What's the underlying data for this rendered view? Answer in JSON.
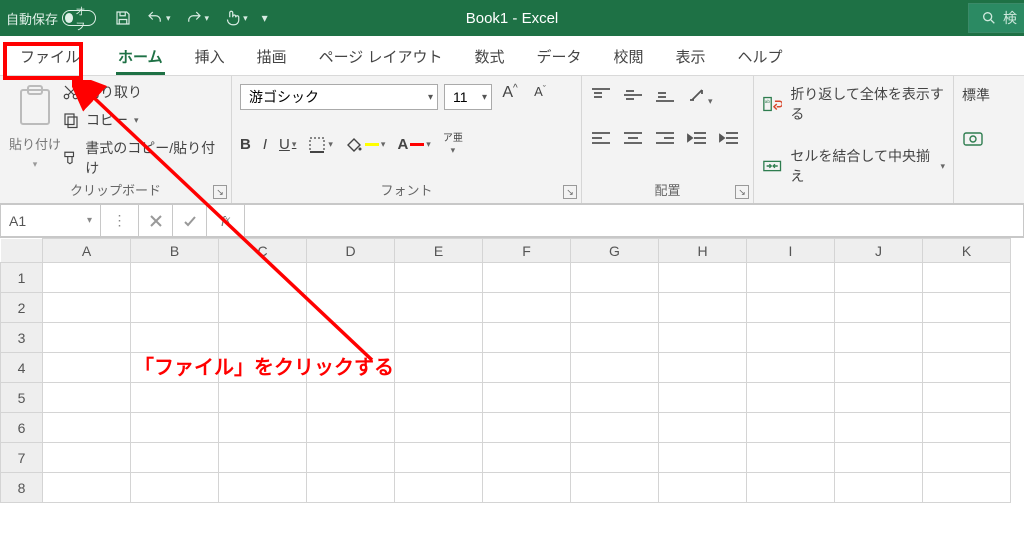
{
  "title": "Book1  -  Excel",
  "autosave_label": "自動保存",
  "autosave_state": "オフ",
  "search_placeholder": "検",
  "tabs": {
    "file": "ファイル",
    "home": "ホーム",
    "insert": "挿入",
    "draw": "描画",
    "pagelayout": "ページ レイアウト",
    "formulas": "数式",
    "data": "データ",
    "review": "校閲",
    "view": "表示",
    "help": "ヘルプ"
  },
  "ribbon": {
    "clipboard": {
      "paste": "貼り付け",
      "cut": "切り取り",
      "copy": "コピー",
      "format_painter": "書式のコピー/貼り付け",
      "label": "クリップボード"
    },
    "font": {
      "name": "游ゴシック",
      "size": "11",
      "ruby": "ア亜",
      "label": "フォント"
    },
    "align": {
      "label": "配置"
    },
    "wrap": {
      "wrap": "折り返して全体を表示する",
      "merge": "セルを結合して中央揃え"
    },
    "number": {
      "label": "標準"
    }
  },
  "namebox": "A1",
  "columns": [
    "A",
    "B",
    "C",
    "D",
    "E",
    "F",
    "G",
    "H",
    "I",
    "J",
    "K"
  ],
  "rows": [
    "1",
    "2",
    "3",
    "4",
    "5",
    "6",
    "7",
    "8"
  ],
  "annotation": "「ファイル」をクリックする"
}
